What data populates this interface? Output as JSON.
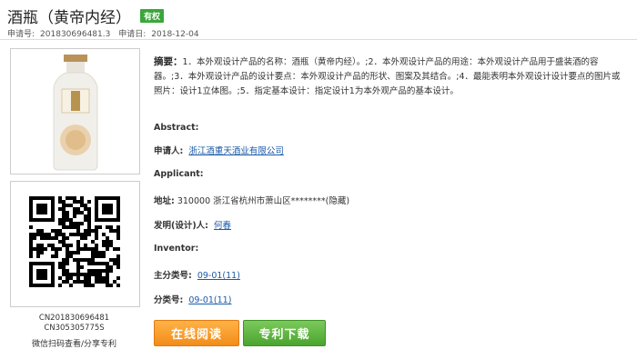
{
  "header": {
    "title": "酒瓶（黄帝内经）",
    "badge": "有权",
    "application_no_label": "申请号:",
    "application_no": "201830696481.3",
    "application_date_label": "申请日:",
    "application_date": "2018-12-04"
  },
  "left_panel": {
    "product_image": "bottle-image",
    "qr_code": "qr-code",
    "code_1": "CN201830696481",
    "code_2": "CN305305775S",
    "qr_caption": "微信扫码查看/分享专利"
  },
  "details": {
    "abstract_label": "摘要：",
    "abstract_text": "1．本外观设计产品的名称：酒瓶（黄帝内经）。;2．本外观设计产品的用途：本外观设计产品用于盛装酒的容器。;3．本外观设计产品的设计要点：本外观设计产品的形状、图案及其结合。;4．最能表明本外观设计设计要点的图片或照片：设计1立体图。;5．指定基本设计：指定设计1为本外观产品的基本设计。",
    "abstract_en_label": "Abstract:",
    "applicant_label": "申请人:",
    "applicant": "浙江酒重天酒业有限公司",
    "applicant_en_label": "Applicant:",
    "address_label": "地址:",
    "address": "310000 浙江省杭州市萧山区********(隐藏)",
    "inventor_label": "发明(设计)人:",
    "inventor": "何春",
    "inventor_en_label": "Inventor:",
    "main_class_label": "主分类号:",
    "main_class": "09-01(11)",
    "class_label": "分类号:",
    "class": "09-01(11)"
  },
  "buttons": {
    "read_online": "在线阅读",
    "download": "专利下载"
  },
  "colors": {
    "badge": "#3aa63a",
    "link": "#1a5aa8",
    "read_button": "#f28c1a",
    "download_button": "#4aa52e"
  }
}
